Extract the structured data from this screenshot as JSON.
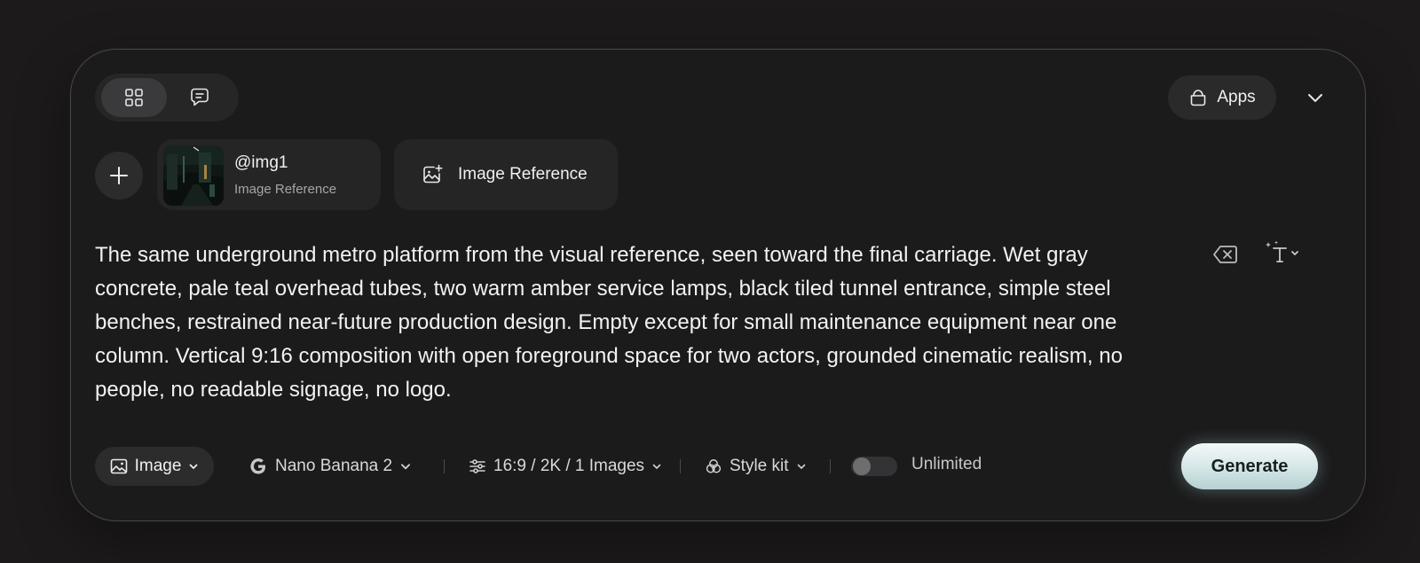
{
  "header": {
    "modes": [
      {
        "name": "grid-view",
        "icon": "grid-icon",
        "active": true
      },
      {
        "name": "chat-view",
        "icon": "chat-bubble-icon",
        "active": false
      }
    ],
    "apps_label": "Apps",
    "apps_icon": "bag-icon",
    "collapse_icon": "chevron-down-icon"
  },
  "references": {
    "add_icon": "plus-icon",
    "items": [
      {
        "tag": "@img1",
        "type": "Image Reference",
        "thumbnail": "metro-platform-thumbnail"
      }
    ],
    "add_reference_label": "Image Reference",
    "add_reference_icon": "image-add-icon"
  },
  "prompt": {
    "text": "The same underground metro platform from the visual reference, seen toward the final carriage. Wet gray concrete, pale teal overhead tubes, two warm amber service lamps, black tiled tunnel entrance, simple steel benches, restrained near-future production design. Empty except for small maintenance equipment near one column. Vertical 9:16 composition with open foreground space for two actors, grounded cinematic realism, no people, no readable signage, no logo.",
    "clear_icon": "backspace-clear-icon",
    "enhance_icon": "sparkle-text-icon"
  },
  "toolbar": {
    "type_label": "Image",
    "model_label": "Nano Banana 2",
    "settings_label": "16:9 / 2K / 1 Images",
    "style_label": "Style kit",
    "unlimited_label": "Unlimited",
    "unlimited_on": false,
    "generate_label": "Generate"
  },
  "colors": {
    "page_bg": "#1c1a1b",
    "panel_bg": "#1b1b1c",
    "chip_bg": "#252526",
    "generate_accent": "#d3e6e6"
  }
}
